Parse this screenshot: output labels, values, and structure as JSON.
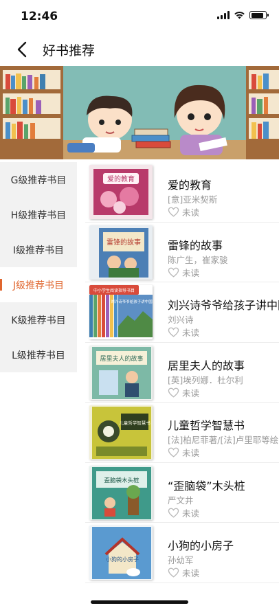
{
  "status_bar": {
    "time": "12:46"
  },
  "nav": {
    "title": "好书推荐"
  },
  "sidebar": {
    "items": [
      {
        "label": "G级推荐书目",
        "active": false
      },
      {
        "label": "H级推荐书目",
        "active": false
      },
      {
        "label": "I级推荐书目",
        "active": false
      },
      {
        "label": "J级推荐书目",
        "active": true
      },
      {
        "label": "K级推荐书目",
        "active": false
      },
      {
        "label": "L级推荐书目",
        "active": false
      }
    ]
  },
  "books": [
    {
      "title": "爱的教育",
      "author": "[意]亚米契斯",
      "status": "未读",
      "cover_text": "爱的教育"
    },
    {
      "title": "雷锋的故事",
      "author": "陈广生，崔家骏",
      "status": "未读",
      "cover_text": "雷锋的故事"
    },
    {
      "title": "刘兴诗爷爷给孩子讲中国地理",
      "author": "刘兴诗",
      "status": "未读",
      "cover_text": "刘兴诗爷爷给孩子讲中国地理",
      "badge_text": "中小学生阅读指导书目"
    },
    {
      "title": "居里夫人的故事",
      "author": "[英]埃列娜．杜尔利",
      "status": "未读",
      "cover_text": "居里夫人的故事"
    },
    {
      "title": "儿童哲学智慧书",
      "author": "[法]柏尼菲著/[法]卢里耶等绘",
      "status": "未读",
      "cover_text": "儿童哲学智慧书"
    },
    {
      "title": "“歪脑袋”木头桩",
      "author": "严文井",
      "status": "未读",
      "cover_text": "歪脑袋木头桩"
    },
    {
      "title": "小狗的小房子",
      "author": "孙幼军",
      "status": "未读",
      "cover_text": "小狗的小房子"
    }
  ],
  "colors": {
    "accent": "#e0662e",
    "sidebar_bg": "#f2f2f2",
    "muted_text": "#9a9a9a"
  },
  "icons": {
    "back": "chevron-left-icon",
    "favorite": "heart-outline-icon"
  }
}
